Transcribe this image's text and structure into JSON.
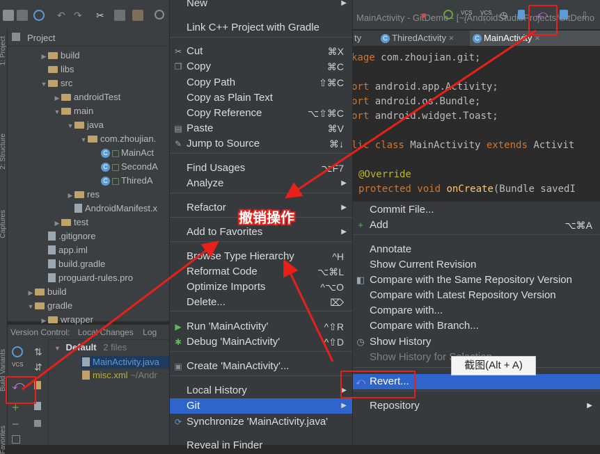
{
  "window": {
    "title_fragment": "MainActivity - GitDemo - [~/AndroidStudioProjects/GitDemo"
  },
  "toolbar": {
    "vcs_label_1": "VCS",
    "vcs_label_2": "VCS"
  },
  "side_tabs": {
    "project": "1: Project",
    "structure": "2: Structure",
    "captures": "Captures",
    "build_variants": "Build Variants",
    "favorites": "Favorites"
  },
  "project_panel": {
    "title": "Project",
    "tree": [
      {
        "label": "build",
        "type": "folder",
        "depth": 2,
        "arrow": "▶"
      },
      {
        "label": "libs",
        "type": "folder",
        "depth": 2,
        "arrow": ""
      },
      {
        "label": "src",
        "type": "folder",
        "depth": 2,
        "arrow": "▼"
      },
      {
        "label": "androidTest",
        "type": "folder",
        "depth": 3,
        "arrow": "▶"
      },
      {
        "label": "main",
        "type": "folder",
        "depth": 3,
        "arrow": "▼"
      },
      {
        "label": "java",
        "type": "folder",
        "depth": 4,
        "arrow": "▼"
      },
      {
        "label": "com.zhoujian.",
        "type": "folder",
        "depth": 5,
        "arrow": "▼"
      },
      {
        "label": "MainAct",
        "type": "class",
        "depth": 6,
        "arrow": ""
      },
      {
        "label": "SecondA",
        "type": "class",
        "depth": 6,
        "arrow": ""
      },
      {
        "label": "ThiredA",
        "type": "class",
        "depth": 6,
        "arrow": ""
      },
      {
        "label": "res",
        "type": "folder",
        "depth": 4,
        "arrow": "▶"
      },
      {
        "label": "AndroidManifest.x",
        "type": "file",
        "depth": 4,
        "arrow": ""
      },
      {
        "label": "test",
        "type": "folder",
        "depth": 3,
        "arrow": "▶"
      },
      {
        "label": ".gitignore",
        "type": "file",
        "depth": 2,
        "arrow": ""
      },
      {
        "label": "app.iml",
        "type": "file",
        "depth": 2,
        "arrow": ""
      },
      {
        "label": "build.gradle",
        "type": "file",
        "depth": 2,
        "arrow": ""
      },
      {
        "label": "proguard-rules.pro",
        "type": "file",
        "depth": 2,
        "arrow": ""
      },
      {
        "label": "build",
        "type": "folder",
        "depth": 1,
        "arrow": "▶"
      },
      {
        "label": "gradle",
        "type": "folder",
        "depth": 1,
        "arrow": "▼"
      },
      {
        "label": "wrapper",
        "type": "folder",
        "depth": 2,
        "arrow": "▶"
      }
    ]
  },
  "version_control": {
    "header": "Version Control:",
    "tab_local_changes": "Local Changes",
    "tab_log": "Log",
    "changelist_name": "Default",
    "changelist_count": "2 files",
    "files": [
      "MainActivity.java",
      "misc.xml"
    ],
    "misc_path": "~/Andr",
    "vcs_label": "VCS"
  },
  "editor": {
    "tabs": [
      "ty",
      "ThiredActivity",
      "MainActivity"
    ],
    "lines": [
      {
        "k": "kage",
        "t": " com.zhoujian.git;"
      },
      {
        "k": "",
        "t": ""
      },
      {
        "k": "ort",
        "t": " android.app.Activity;"
      },
      {
        "k": "ort",
        "t": " android.os.Bundle;"
      },
      {
        "k": "ort",
        "t": " android.widget.Toast;"
      },
      {
        "k": "",
        "t": ""
      },
      {
        "k": "lic class",
        "t": " MainActivity ",
        "k2": "extends",
        "t2": " Activit"
      },
      {
        "k": "",
        "t": ""
      },
      {
        "a": "@Override"
      },
      {
        "k": "protected void",
        "f": " onCreate",
        "t": "(Bundle savedI"
      }
    ]
  },
  "context_menu": {
    "items": [
      {
        "label": "New",
        "shortcut": "",
        "submenu": true
      },
      {
        "label": "Link C++ Project with Gradle"
      },
      {
        "label": "Cut",
        "shortcut": "⌘X",
        "icon": "scissors-icon"
      },
      {
        "label": "Copy",
        "shortcut": "⌘C",
        "icon": "copy-icon"
      },
      {
        "label": "Copy Path",
        "shortcut": "⇧⌘C"
      },
      {
        "label": "Copy as Plain Text"
      },
      {
        "label": "Copy Reference",
        "shortcut": "⌥⇧⌘C"
      },
      {
        "label": "Paste",
        "shortcut": "⌘V",
        "icon": "paste-icon"
      },
      {
        "label": "Jump to Source",
        "shortcut": "⌘↓",
        "icon": "jump-icon"
      },
      {
        "label": "Find Usages",
        "shortcut": "⌥F7"
      },
      {
        "label": "Analyze",
        "submenu": true
      },
      {
        "label": "Refactor",
        "submenu": true
      },
      {
        "label": "Add to Favorites",
        "submenu": true
      },
      {
        "label": "Browse Type Hierarchy",
        "shortcut": "^H"
      },
      {
        "label": "Reformat Code",
        "shortcut": "⌥⌘L"
      },
      {
        "label": "Optimize Imports",
        "shortcut": "^⌥O"
      },
      {
        "label": "Delete...",
        "shortcut": "⌦"
      },
      {
        "label": "Run 'MainActivity'",
        "shortcut": "^⇧R",
        "icon": "run-icon"
      },
      {
        "label": "Debug 'MainActivity'",
        "shortcut": "^⇧D",
        "icon": "debug-icon"
      },
      {
        "label": "Create 'MainActivity'...",
        "icon": "create-icon"
      },
      {
        "label": "Local History",
        "submenu": true
      },
      {
        "label": "Git",
        "submenu": true,
        "highlighted": true
      },
      {
        "label": "Synchronize 'MainActivity.java'",
        "icon": "sync-icon"
      },
      {
        "label": "Reveal in Finder"
      }
    ]
  },
  "git_menu": {
    "items": [
      {
        "label": "Commit File..."
      },
      {
        "label": "Add",
        "shortcut": "⌥⌘A",
        "icon": "plus-icon"
      },
      {
        "label": "Annotate"
      },
      {
        "label": "Show Current Revision"
      },
      {
        "label": "Compare with the Same Repository Version",
        "icon": "compare-icon"
      },
      {
        "label": "Compare with Latest Repository Version"
      },
      {
        "label": "Compare with..."
      },
      {
        "label": "Compare with Branch..."
      },
      {
        "label": "Show History",
        "icon": "history-icon"
      },
      {
        "label": "Show History for Selection"
      },
      {
        "label": "Revert...",
        "icon": "revert-icon",
        "highlighted": true
      },
      {
        "label": "Repository",
        "submenu": true
      }
    ]
  },
  "annotation": {
    "text": "撤销操作",
    "tooltip": "截图(Alt + A)"
  },
  "colors": {
    "highlight": "#2f65ca",
    "annotation_red": "#e8201a",
    "menu_bg": "#373a3c"
  }
}
